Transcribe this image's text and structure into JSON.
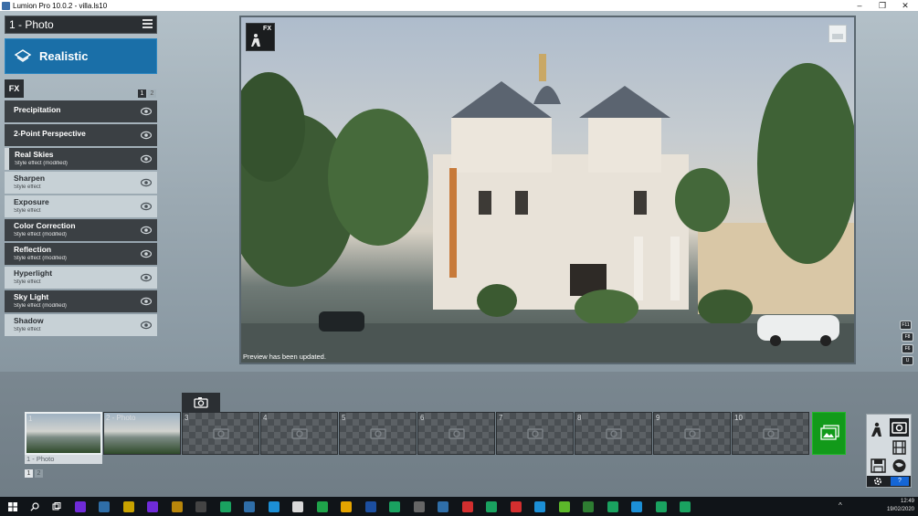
{
  "window": {
    "title": "Lumion Pro 10.0.2 - villa.ls10",
    "minimize": "–",
    "maximize": "❐",
    "close": "✕"
  },
  "mode": {
    "label": "1 - Photo",
    "menu_icon": "hamburger-menu-icon"
  },
  "style": {
    "label": "Realistic",
    "icon": "layers-icon",
    "color": "#1a6fa8"
  },
  "fx_panel": {
    "tab_label": "FX",
    "pages": [
      "1",
      "2"
    ],
    "effects": [
      {
        "name": "Precipitation",
        "subtitle": "",
        "shade": "dark"
      },
      {
        "name": "2-Point Perspective",
        "subtitle": "",
        "shade": "dark"
      },
      {
        "name": "Real Skies",
        "subtitle": "Style effect (modified)",
        "shade": "dark"
      },
      {
        "name": "Sharpen",
        "subtitle": "Style effect",
        "shade": "light"
      },
      {
        "name": "Exposure",
        "subtitle": "Style effect",
        "shade": "light"
      },
      {
        "name": "Color Correction",
        "subtitle": "Style effect (modified)",
        "shade": "dark"
      },
      {
        "name": "Reflection",
        "subtitle": "Style effect (modified)",
        "shade": "dark"
      },
      {
        "name": "Hyperlight",
        "subtitle": "Style effect",
        "shade": "light"
      },
      {
        "name": "Sky Light",
        "subtitle": "Style effect (modified)",
        "shade": "dark"
      },
      {
        "name": "Shadow",
        "subtitle": "Style effect",
        "shade": "light"
      }
    ]
  },
  "viewport": {
    "fx_badge": "FX",
    "status": "Preview has been updated.",
    "side_keys": [
      "F11",
      "F8",
      "F6",
      "U"
    ]
  },
  "timeline": {
    "slots": [
      {
        "number": "1",
        "filled": true,
        "label": ""
      },
      {
        "number": "2 - Photo",
        "filled": true,
        "label": ""
      },
      {
        "number": "3",
        "filled": false
      },
      {
        "number": "4",
        "filled": false
      },
      {
        "number": "5",
        "filled": false
      },
      {
        "number": "6",
        "filled": false
      },
      {
        "number": "7",
        "filled": false
      },
      {
        "number": "8",
        "filled": false
      },
      {
        "number": "9",
        "filled": false
      },
      {
        "number": "10",
        "filled": false
      }
    ],
    "selected_caption": "1 - Photo",
    "pages": [
      "1",
      "2"
    ]
  },
  "toolbox": {
    "help_label": "?"
  },
  "taskbar": {
    "time": "12:49",
    "date": "19/02/2020",
    "icon_colors": [
      "#6f2bd8",
      "#2f6ea8",
      "#c8a200",
      "#6f2bd8",
      "#b8860b",
      "#444",
      "#1aa260",
      "#2f6ea8",
      "#1c8fd6",
      "#d9d9d9",
      "#1fa34a",
      "#e5a400",
      "#1c4fa0",
      "#1aa260",
      "#666",
      "#2f6ea8",
      "#d32f2f",
      "#1aa260",
      "#d32f2f",
      "#1c8fd6",
      "#5cb82a",
      "#2e7d32",
      "#1aa260",
      "#1c8fd6",
      "#1aa260",
      "#1aa260",
      "#1c8fd6",
      "#e2b23a"
    ]
  }
}
